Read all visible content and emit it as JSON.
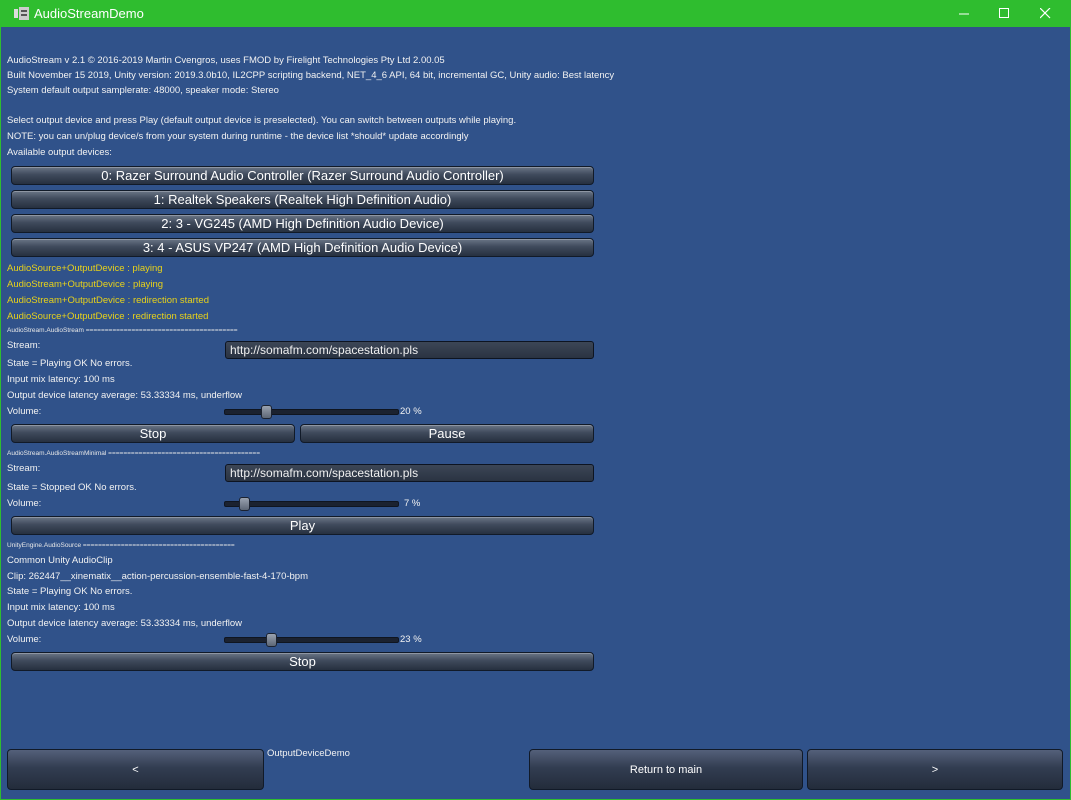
{
  "window": {
    "title": "AudioStreamDemo"
  },
  "header": {
    "line1": "AudioStream v 2.1 © 2016-2019 Martin Cvengros, uses FMOD by Firelight Technologies Pty Ltd 2.00.05",
    "line2": "Built November 15 2019, Unity version: 2019.3.0b10, IL2CPP scripting backend, NET_4_6 API, 64 bit, incremental GC,  Unity audio: Best latency",
    "line3": "System default output samplerate: 48000, speaker mode: Stereo",
    "instr1": "Select output device and press Play (default output device is preselected). You can switch between outputs while playing.",
    "instr2": "NOTE: you can un/plug device/s from your system during runtime - the device list *should* update accordingly",
    "instr3": "Available output devices:"
  },
  "devices": [
    "0: Razer Surround Audio Controller (Razer Surround Audio Controller)",
    "1: Realtek Speakers (Realtek High Definition Audio)",
    "2: 3 - VG245 (AMD High Definition Audio Device)",
    "3: 4 - ASUS VP247 (AMD High Definition Audio Device)"
  ],
  "log": [
    "AudioSource+OutputDevice : playing",
    "AudioStream+OutputDevice : playing",
    "AudioStream+OutputDevice : redirection started",
    "AudioSource+OutputDevice : redirection started"
  ],
  "audiostream": {
    "header": "AudioStream.AudioStream   ========================================",
    "stream_label": "Stream:",
    "stream_value": "http://somafm.com/spacestation.pls",
    "state": "State = Playing OK No errors.",
    "latency": "Input mix latency: 100 ms",
    "output_latency": "Output device latency average: 53.33334 ms, underflow",
    "volume_label": "Volume:",
    "volume": 20,
    "volume_text": "20 %",
    "stop": "Stop",
    "pause": "Pause"
  },
  "minimal": {
    "header": "AudioStream.AudioStreamMinimal   ========================================",
    "stream_label": "Stream:",
    "stream_value": "http://somafm.com/spacestation.pls",
    "state": "State = Stopped OK No errors.",
    "volume_label": "Volume:",
    "volume": 7,
    "volume_text": "7 %",
    "play": "Play"
  },
  "unity": {
    "header": "UnityEngine.AudioSource   ========================================",
    "clip_title": "Common Unity AudioClip",
    "clip": "Clip: 262447__xinematix__action-percussion-ensemble-fast-4-170-bpm",
    "state": "State = Playing OK No errors.",
    "latency": "Input mix latency: 100 ms",
    "output_latency": "Output device latency average: 53.33334 ms, underflow",
    "volume_label": "Volume:",
    "volume": 23,
    "volume_text": "23 %",
    "stop": "Stop"
  },
  "footer": {
    "scene_name": "OutputDeviceDemo",
    "prev": "<",
    "return": "Return to main",
    "next": ">"
  }
}
